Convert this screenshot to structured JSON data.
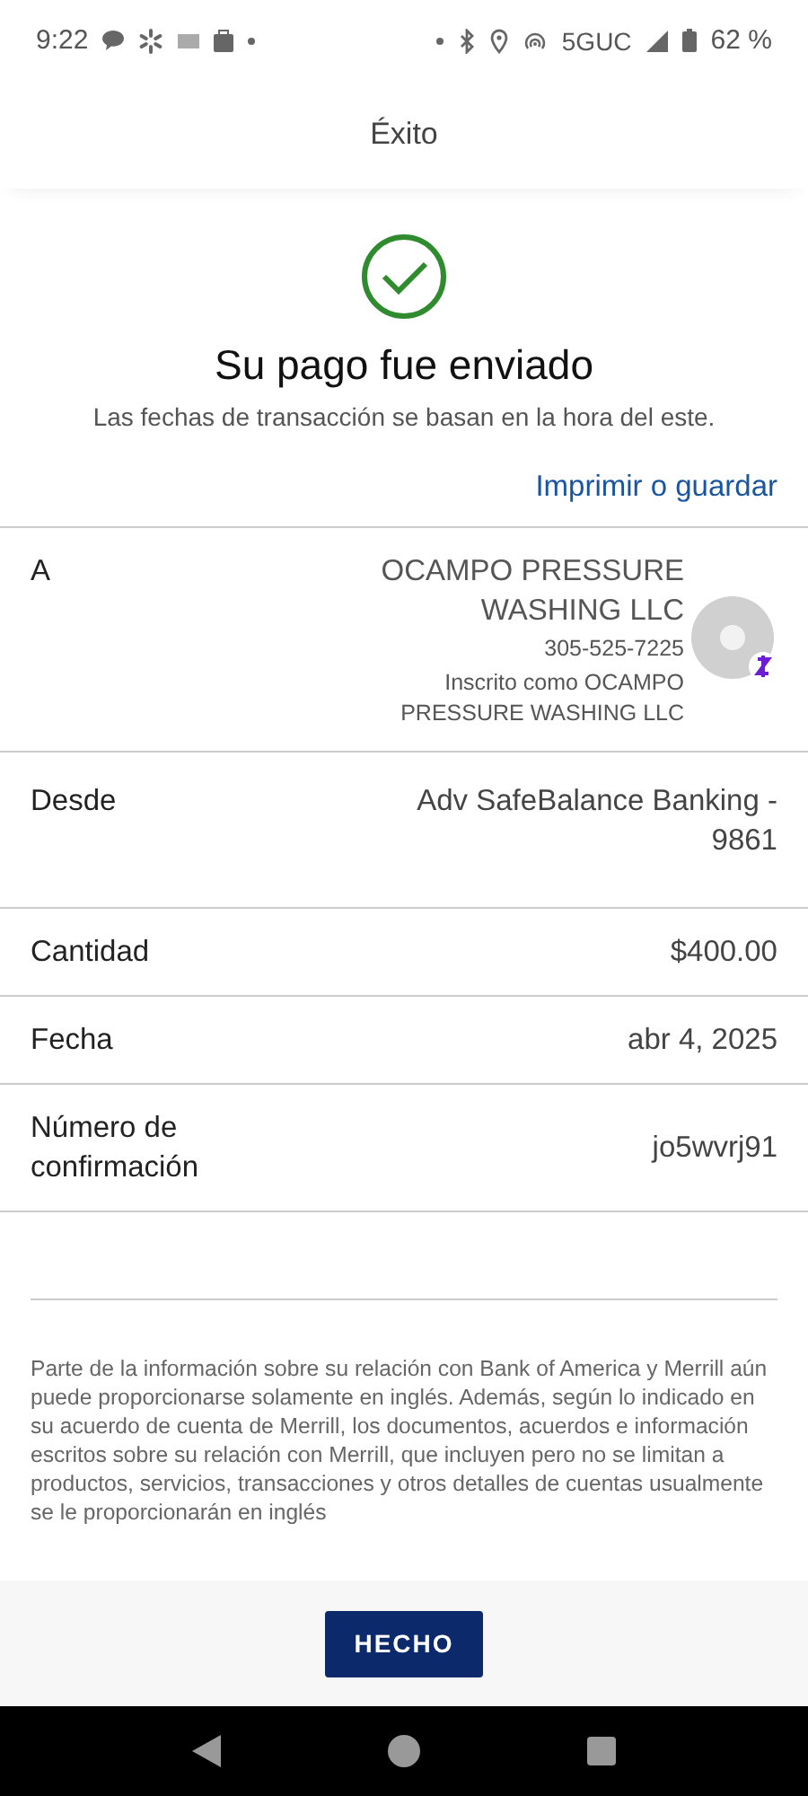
{
  "status_bar": {
    "time": "9:22",
    "network": "5GUC",
    "battery": "62 %"
  },
  "header": {
    "title": "Éxito"
  },
  "confirmation": {
    "title": "Su pago fue enviado",
    "subtitle": "Las fechas de transacción se basan en la hora del este.",
    "link": "Imprimir o guardar"
  },
  "details": [
    {
      "kind": "recipient",
      "label": "A",
      "name": "OCAMPO PRESSURE WASHING LLC",
      "phone": "305-525-7225",
      "note": "Inscrito como OCAMPO PRESSURE WASHING LLC"
    },
    {
      "kind": "plain",
      "label": "Desde",
      "value": "Adv SafeBalance Banking - 9861"
    },
    {
      "kind": "plain",
      "label": "Cantidad",
      "value": "$400.00"
    },
    {
      "kind": "plain",
      "label": "Fecha",
      "value": "abr 4, 2025"
    },
    {
      "kind": "plain",
      "label": "Número de confirmación",
      "value": "jo5wvrj91"
    }
  ],
  "disclaimer": "Parte de la información sobre su relación con Bank of America y Merrill aún puede proporcionarse solamente en inglés. Además, según lo indicado en su acuerdo de cuenta de Merrill, los documentos, acuerdos e información escritos sobre su relación con Merrill, que incluyen pero no se limitan a productos, servicios, transacciones y otros detalles de cuentas usualmente se le proporcionarán en inglés",
  "button": "HECHO"
}
